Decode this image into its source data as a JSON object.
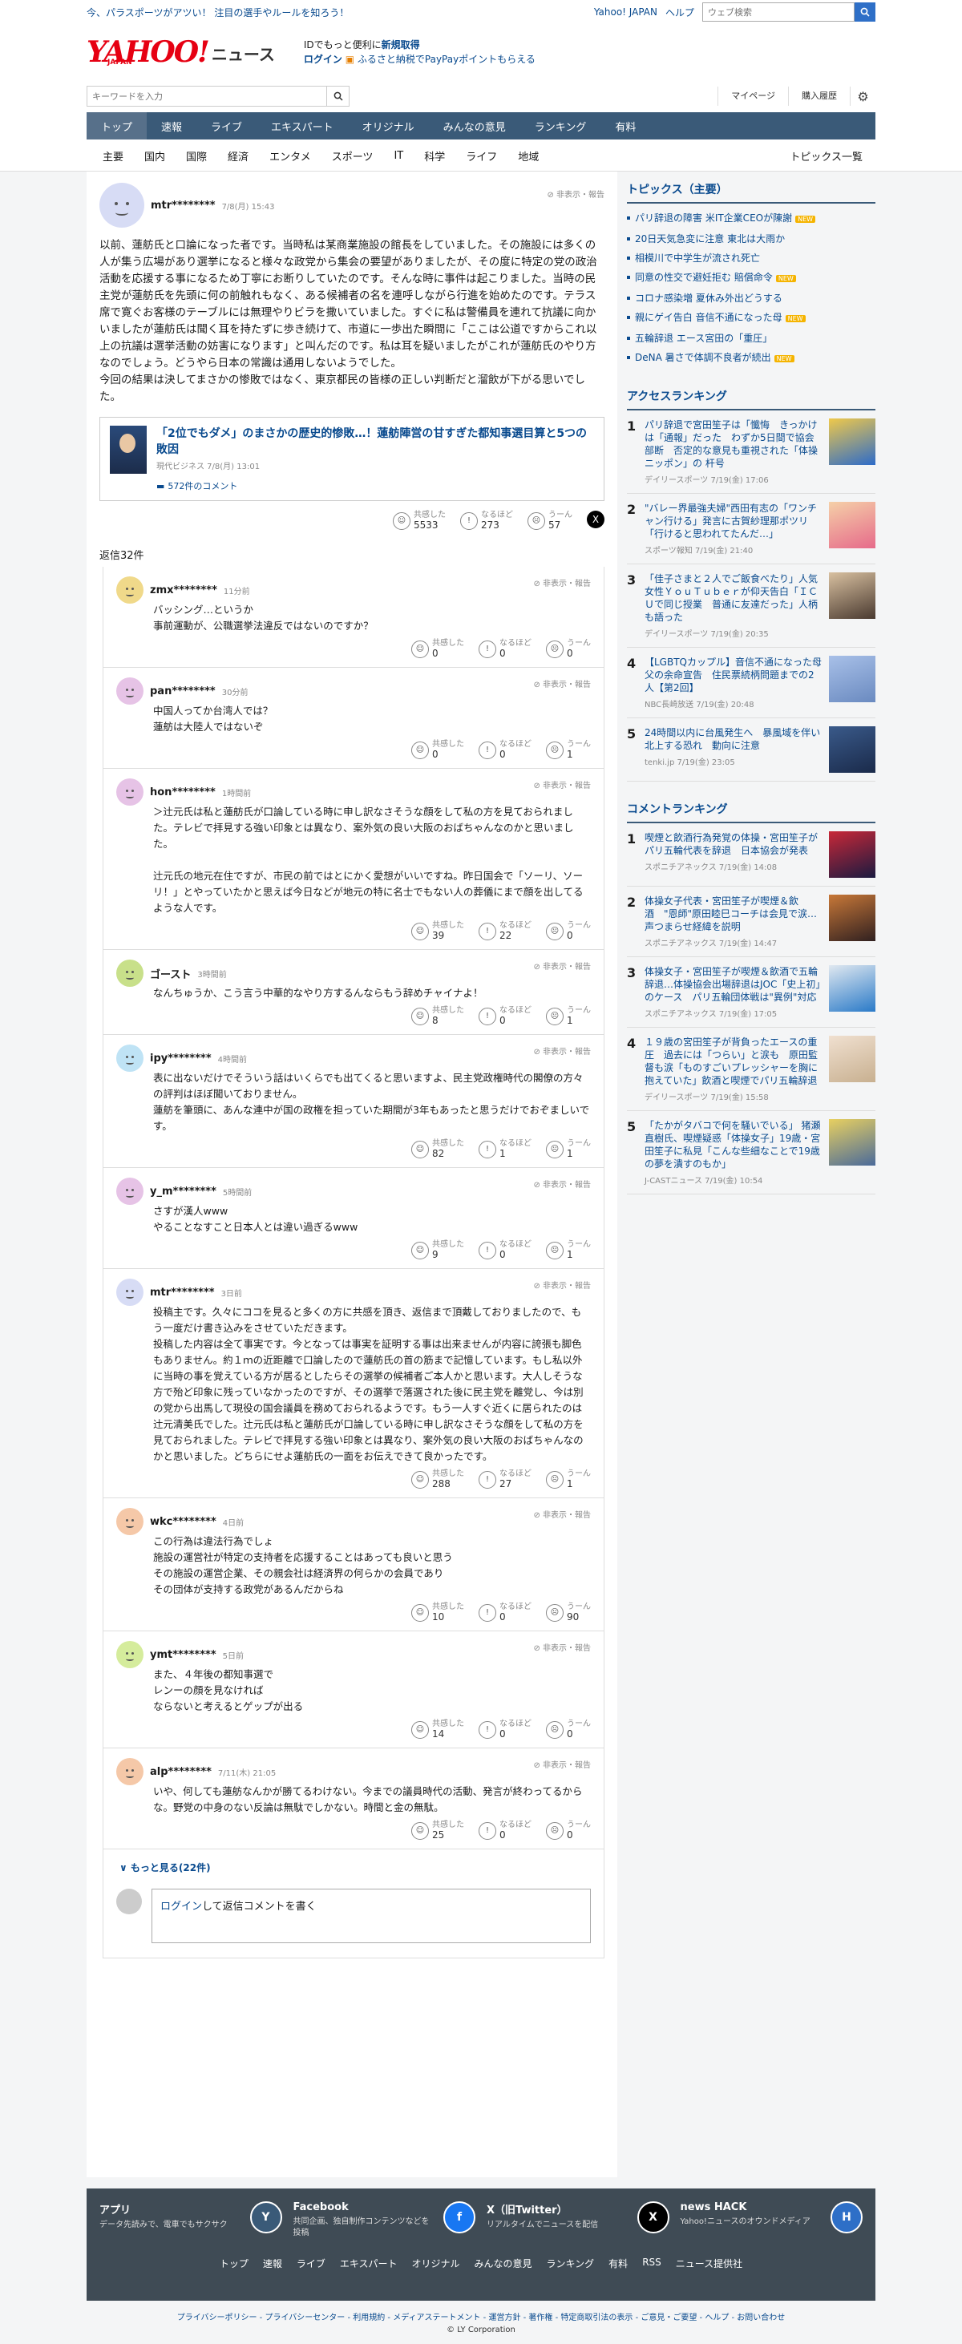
{
  "topbar": {
    "notice": "今、パラスポーツがアツい！ 注目の選手やルールを知ろう！",
    "yj": "Yahoo! JAPAN",
    "help": "ヘルプ",
    "web_search_placeholder": "ウェブ検索"
  },
  "logo": {
    "brand": "YAHOO!",
    "sub": "JAPAN",
    "news": "ニュース"
  },
  "promo": {
    "line1_pre": "IDでもっと便利に",
    "line1_link": "新規取得",
    "login": "ログイン",
    "line2": "ふるさと納税でPayPayポイントもらえる"
  },
  "keyword": {
    "placeholder": "キーワードを入力",
    "mypage": "マイページ",
    "history": "購入履歴"
  },
  "gnav": [
    "トップ",
    "速報",
    "ライブ",
    "エキスパート",
    "オリジナル",
    "みんなの意見",
    "ランキング",
    "有料"
  ],
  "subnav": [
    "主要",
    "国内",
    "国際",
    "経済",
    "エンタメ",
    "スポーツ",
    "IT",
    "科学",
    "ライフ",
    "地域"
  ],
  "subnav_list": "トピックス一覧",
  "main_comment": {
    "user": "mtr********",
    "date": "7/8(月) 15:43",
    "report": "非表示・報告",
    "text": "以前、蓮舫氏と口論になった者です。当時私は某商業施設の館長をしていました。その施設には多くの人が集う広場があり選挙になると様々な政党から集会の要望がありましたが、その度に特定の党の政治活動を応援する事になるため丁寧にお断りしていたのです。そんな時に事件は起こりました。当時の民主党が蓮舫氏を先頭に何の前触れもなく、ある候補者の名を連呼しながら行進を始めたのです。テラス席で寛ぐお客様のテーブルには無理やりビラを撒いていました。すぐに私は警備員を連れて抗議に向かいましたが蓮舫氏は聞く耳を持たずに歩き続けて、市道に一歩出た瞬間に「ここは公道ですからこれ以上の抗議は選挙活動の妨害になります」と叫んだのです。私は耳を疑いましたがこれが蓮舫氏のやり方なのでしょう。どうやら日本の常識は通用しないようでした。\n今回の結果は決してまさかの惨敗ではなく、東京都民の皆様の正しい判断だと溜飲が下がる思いでした。",
    "article_title": "「2位でもダメ」のまさかの歴史的惨敗…！蓮舫陣営の甘すぎた都知事選目算と5つの敗因",
    "article_src": "現代ビジネス 7/8(月) 13:01",
    "article_comments": "572件のコメント",
    "reactions": {
      "empathy_label": "共感した",
      "empathy": "5533",
      "insight_label": "なるほど",
      "insight": "273",
      "hmm_label": "うーん",
      "hmm": "57"
    }
  },
  "reply_count": "返信32件",
  "replies": [
    {
      "user": "zmx********",
      "date": "11分前",
      "text": "バッシング…というか\n事前運動が、公職選挙法違反ではないのですか？",
      "e": "0",
      "i": "0",
      "h": "0",
      "color": "#f0d98a"
    },
    {
      "user": "pan********",
      "date": "30分前",
      "text": "中国人ってか台湾人では？\n蓮舫は大陸人ではないぞ",
      "e": "0",
      "i": "0",
      "h": "1",
      "color": "#e6c3e6"
    },
    {
      "user": "hon********",
      "date": "1時間前",
      "text": "＞辻元氏は私と蓮舫氏が口論している時に申し訳なさそうな顔をして私の方を見ておられました。テレビで拝見する強い印象とは異なり、案外気の良い大阪のおばちゃんなのかと思いました。\n\n辻元氏の地元在住ですが、市民の前ではとにかく愛想がいいですね。昨日国会で「ソーリ、ソーリ！」とやっていたかと思えば今日などが地元の特に名士でもない人の葬儀にまで顔を出してるような人です。",
      "e": "39",
      "i": "22",
      "h": "0",
      "color": "#e6c3e6"
    },
    {
      "user": "ゴースト",
      "date": "3時間前",
      "text": "なんちゅうか、こう言う中華的なやり方するんならもう辞めチャイナよ！",
      "e": "8",
      "i": "0",
      "h": "1",
      "color": "#c8e08a"
    },
    {
      "user": "ipy********",
      "date": "4時間前",
      "text": "表に出ないだけでそういう話はいくらでも出てくると思いますよ、民主党政権時代の閣僚の方々の評判はほぼ聞いておりません。\n蓮舫を筆頭に、あんな連中が国の政権を担っていた期間が3年もあったと思うだけでおぞましいです。",
      "e": "82",
      "i": "1",
      "h": "1",
      "color": "#bfe3f5"
    },
    {
      "user": "y_m********",
      "date": "5時間前",
      "text": "さすが漢人www\nやることなすこと日本人とは違い過ぎるwww",
      "e": "9",
      "i": "0",
      "h": "1",
      "color": "#e6c3e6"
    },
    {
      "user": "mtr********",
      "date": "3日前",
      "text": "投稿主です。久々にココを見ると多くの方に共感を頂き、返信まで頂戴しておりましたので、もう一度だけ書き込みをさせていただきます。\n投稿した内容は全て事実です。今となっては事実を証明する事は出来ませんが内容に誇張も脚色もありません。約１ｍの近距離で口論したので蓮舫氏の首の筋まで記憶しています。もし私以外に当時の事を覚えている方が居るとしたらその選挙の候補者ご本人かと思います。大人しそうな方で殆ど印象に残っていなかったのですが、その選挙で落選された後に民主党を離党し、今は別の党から出馬して現役の国会議員を務めておられるようです。もう一人すぐ近くに居られたのは辻元清美氏でした。辻元氏は私と蓮舫氏が口論している時に申し訳なさそうな顔をして私の方を見ておられました。テレビで拝見する強い印象とは異なり、案外気の良い大阪のおばちゃんなのかと思いました。どちらにせよ蓮舫氏の一面をお伝えできて良かったです。",
      "e": "288",
      "i": "27",
      "h": "1",
      "color": "#d7dcf5"
    },
    {
      "user": "wkc********",
      "date": "4日前",
      "text": "この行為は違法行為でしょ\n施設の運営社が特定の支持者を応援することはあっても良いと思う\nその施設の運営企業、その親会社は経済界の何らかの会員であり\nその団体が支持する政党があるんだからね",
      "e": "10",
      "i": "0",
      "h": "90",
      "color": "#f5c8a8"
    },
    {
      "user": "ymt********",
      "date": "5日前",
      "text": "また、４年後の都知事選で\nレンーの顔を見なければ\nならないと考えるとゲップが出る",
      "e": "14",
      "i": "0",
      "h": "0",
      "color": "#d5ec9c"
    },
    {
      "user": "alp********",
      "date": "7/11(木) 21:05",
      "text": "いや、何しても蓮舫なんかが勝てるわけない。今までの議員時代の活動、発言が終わってるからな。野党の中身のない反論は無駄でしかない。時間と金の無駄。",
      "e": "25",
      "i": "0",
      "h": "0",
      "color": "#f5c8a8"
    }
  ],
  "react_labels": {
    "e": "共感した",
    "i": "なるほど",
    "h": "うーん"
  },
  "more": "もっと見る(22件)",
  "post": {
    "login": "ログイン",
    "rest": "して返信コメントを書く"
  },
  "topics": {
    "title": "トピックス（主要）",
    "items": [
      {
        "t": "パリ辞退の障害 米IT企業CEOが陳謝",
        "new": true
      },
      {
        "t": "20日天気急変に注意 東北は大雨か",
        "new": false
      },
      {
        "t": "相模川で中学生が流され死亡",
        "new": false
      },
      {
        "t": "同意の性交で避妊拒む 賠償命令",
        "new": true
      },
      {
        "t": "コロナ感染増 夏休み外出どうする",
        "new": false
      },
      {
        "t": "親にゲイ告白 音信不通になった母",
        "new": true
      },
      {
        "t": "五輪辞退 エース宮田の「重圧」",
        "new": false
      },
      {
        "t": "DeNA 暑さで体調不良者が続出",
        "new": true
      }
    ],
    "new_label": "NEW"
  },
  "access": {
    "title": "アクセスランキング",
    "items": [
      {
        "n": "1",
        "t": "パリ辞退で宮田笙子は「懺悔　きっかけは「通報」だった　わずか5日間で協会部断　否定的な意見も重視された「体操ニッポン」の 杆号",
        "src": "デイリースポーツ 7/19(金) 17:06",
        "c1": "#f0c94a",
        "c2": "#2d6bc9"
      },
      {
        "n": "2",
        "t": "\"バレー界最強夫婦\"西田有志の「ワンチャン行ける」発言に古賀紗理那ポツリ「行けると思われてたんだ…」",
        "src": "スポーツ報知 7/19(金) 21:40",
        "c1": "#f5d0a8",
        "c2": "#e66a8a"
      },
      {
        "n": "3",
        "t": "「佳子さまと２人でご飯食べたり」人気女性ＹｏｕＴｕｂｅｒが仰天告白「ＩＣＵで同じ授業　普通に友達だった」人柄も語った",
        "src": "デイリースポーツ 7/19(金) 20:35",
        "c1": "#d8c0a0",
        "c2": "#4a3a30"
      },
      {
        "n": "4",
        "t": "【LGBTQカップル】音信不通になった母　父の余命宣告　住民票続柄問題までの2人【第2回】",
        "src": "NBC長崎放送 7/19(金) 20:48",
        "c1": "#a8c0e8",
        "c2": "#6a8ac0"
      },
      {
        "n": "5",
        "t": "24時間以内に台風発生へ　暴風域を伴い北上する恐れ　動向に注意",
        "src": "tenki.jp 7/19(金) 23:05",
        "c1": "#3a5a8a",
        "c2": "#1a2a4a"
      }
    ]
  },
  "comment_rank": {
    "title": "コメントランキング",
    "items": [
      {
        "n": "1",
        "t": "喫煙と飲酒行為発覚の体操・宮田笙子がパリ五輪代表を辞退　日本協会が発表",
        "src": "スポニチアネックス 7/19(金) 14:08",
        "c1": "#c82838",
        "c2": "#1a1a40"
      },
      {
        "n": "2",
        "t": "体操女子代表・宮田笙子が喫煙＆飲酒　\"恩師\"原田睦巳コーチは会見で涙…声つまらせ経緯を説明",
        "src": "スポニチアネックス 7/19(金) 14:47",
        "c1": "#c87838",
        "c2": "#302020"
      },
      {
        "n": "3",
        "t": "体操女子・宮田笙子が喫煙＆飲酒で五輪辞退…体操協会出場辞退はJOC「史上初」のケース　パリ五輪団体戦は\"異例\"対応",
        "src": "スポニチアネックス 7/19(金) 17:05",
        "c1": "#e0e8f0",
        "c2": "#2a7ac8"
      },
      {
        "n": "4",
        "t": "１９歳の宮田笙子が背負ったエースの重圧　過去には「つらい」と涙も　原田監督も涙「ものすごいプレッシャーを胸に抱えていた」飲酒と喫煙でパリ五輪辞退",
        "src": "デイリースポーツ 7/19(金) 15:58",
        "c1": "#f0e0d0",
        "c2": "#c8b090"
      },
      {
        "n": "5",
        "t": "「たかがタバコで何を騒いでいる」 猪瀬直樹氏、喫煙疑惑「体操女子」19歳・宮田笙子に私見「こんな些細なことで19歳の夢を潰すのもか」",
        "src": "J-CASTニュース 7/19(金) 10:54",
        "c1": "#e8d060",
        "c2": "#4a6a9a"
      }
    ]
  },
  "footer": {
    "apps": [
      {
        "name": "アプリ",
        "desc": "データ先読みで、電車でもサクサク",
        "icon": "Y"
      },
      {
        "name": "Facebook",
        "desc": "共同企画、独自制作コンテンツなどを投稿",
        "icon": "f"
      },
      {
        "name": "X（旧Twitter）",
        "desc": "リアルタイムでニュースを配信",
        "icon": "X"
      },
      {
        "name": "news HACK",
        "desc": "Yahoo!ニュースのオウンドメディア",
        "icon": "H"
      }
    ],
    "links": [
      "トップ",
      "速報",
      "ライブ",
      "エキスパート",
      "オリジナル",
      "みんなの意見",
      "ランキング",
      "有料",
      "RSS",
      "ニュース提供社"
    ],
    "legal": "プライバシーポリシー - プライバシーセンター - 利用規約 - メディアステートメント - 運営方針 - 著作権 - 特定商取引法の表示 - ご意見・ご要望 - ヘルプ - お問い合わせ",
    "copy": "© LY Corporation"
  }
}
